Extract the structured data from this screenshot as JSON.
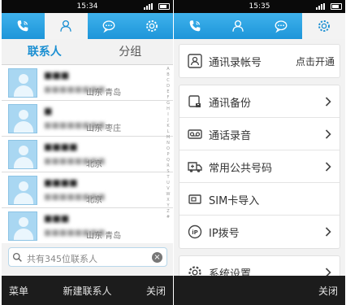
{
  "left": {
    "time": "15:34",
    "subtabs": [
      "联系人",
      "分组"
    ],
    "index_letters": "ABCDEFGHIJKLMNOPQRSTUVWXYZ#",
    "contacts": [
      {
        "name": "■■■",
        "phone": "■■■■■■■■",
        "loc": "山东 青岛"
      },
      {
        "name": "■",
        "phone": "■■■■■■■■",
        "loc": "山东 枣庄"
      },
      {
        "name": "■■■■",
        "phone": "■■■■■■■■",
        "loc": "北京"
      },
      {
        "name": "■■■■",
        "phone": "■■■■■■■■",
        "loc": "北京"
      },
      {
        "name": "■■■",
        "phone": "■■■■■■■■",
        "loc": "山东 青岛"
      }
    ],
    "search": {
      "text": "共有345位联系人"
    },
    "bottom": {
      "menu": "菜单",
      "new_contact": "新建联系人",
      "close": "关闭"
    }
  },
  "right": {
    "time": "15:35",
    "account": {
      "label": "通讯录帐号",
      "action": "点击开通"
    },
    "items": [
      {
        "label": "通讯备份"
      },
      {
        "label": "通话录音"
      },
      {
        "label": "常用公共号码"
      },
      {
        "label": "SIM卡导入"
      },
      {
        "label": "IP拨号"
      }
    ],
    "settings": {
      "label": "系统设置"
    },
    "bottom": {
      "close": "关闭"
    }
  },
  "icons": {
    "tabs": [
      "phone-icon",
      "contacts-icon",
      "message-icon",
      "settings-icon"
    ]
  }
}
